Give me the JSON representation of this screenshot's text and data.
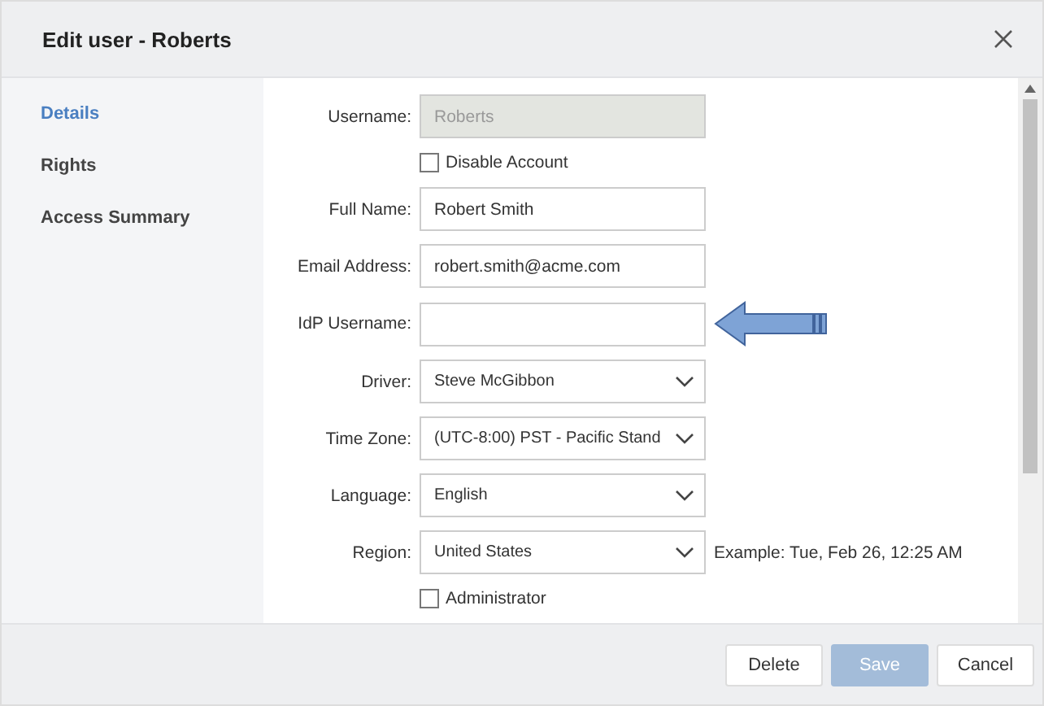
{
  "dialog": {
    "title": "Edit user - Roberts"
  },
  "sidebar": {
    "items": [
      {
        "label": "Details",
        "selected": true
      },
      {
        "label": "Rights",
        "selected": false
      },
      {
        "label": "Access Summary",
        "selected": false
      }
    ]
  },
  "form": {
    "fields": [
      {
        "kind": "text",
        "label": "Username:",
        "value": "Roberts",
        "disabled": true
      },
      {
        "kind": "checkbox",
        "label": "Disable Account",
        "checked": false
      },
      {
        "kind": "text",
        "label": "Full Name:",
        "value": "Robert Smith",
        "disabled": false
      },
      {
        "kind": "text",
        "label": "Email Address:",
        "value": "robert.smith@acme.com",
        "disabled": false
      },
      {
        "kind": "text",
        "label": "IdP Username:",
        "disabled": false,
        "pointer": true
      },
      {
        "kind": "select",
        "label": "Driver:",
        "value": "Steve McGibbon"
      },
      {
        "kind": "select",
        "label": "Time Zone:",
        "value": "(UTC-8:00) PST - Pacific Stand"
      },
      {
        "kind": "select",
        "label": "Language:",
        "value": "English"
      },
      {
        "kind": "select",
        "label": "Region:",
        "value": "United States",
        "note": "Example: Tue, Feb 26, 12:25 AM"
      },
      {
        "kind": "checkbox",
        "label": "Administrator",
        "checked": false
      }
    ]
  },
  "footer": {
    "buttons": [
      {
        "label": "Delete",
        "disabled": false,
        "primary": false
      },
      {
        "label": "Save",
        "disabled": true,
        "primary": true
      },
      {
        "label": "Cancel",
        "disabled": false,
        "primary": false
      }
    ]
  }
}
